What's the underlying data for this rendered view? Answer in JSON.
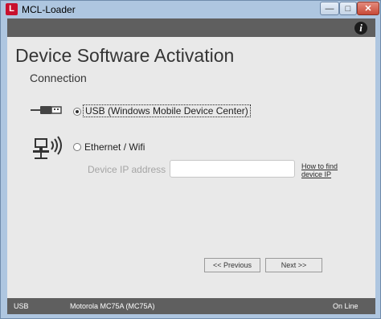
{
  "window": {
    "title": "MCL-Loader",
    "app_icon_letter": "L"
  },
  "page": {
    "title": "Device Software Activation",
    "section": "Connection"
  },
  "options": {
    "usb_label": "USB  (Windows Mobile Device Center)",
    "usb_selected": true,
    "ethernet_label": "Ethernet / Wifi",
    "ethernet_selected": false
  },
  "ip": {
    "label": "Device IP address",
    "value": "",
    "help_link": "How to find device IP"
  },
  "buttons": {
    "previous": "<< Previous",
    "next": "Next >>"
  },
  "status": {
    "connection": "USB",
    "device": "Motorola MC75A (MC75A)",
    "state": "On Line"
  }
}
